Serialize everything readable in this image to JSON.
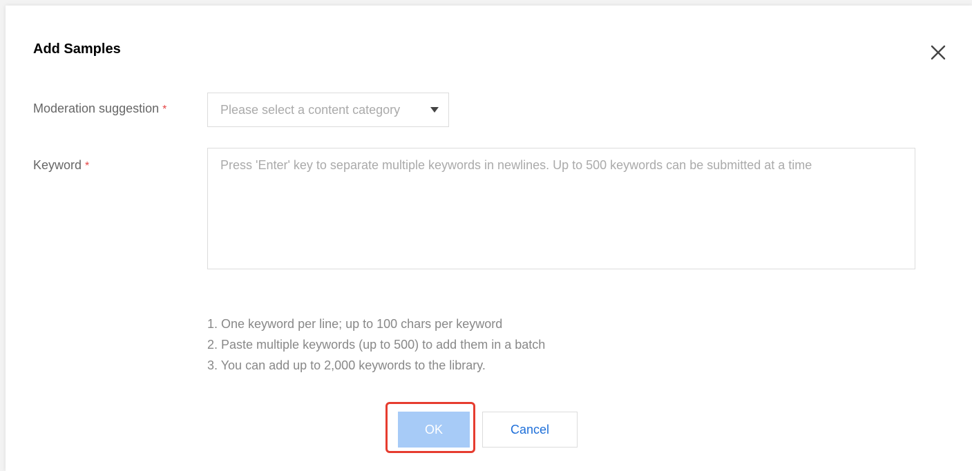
{
  "dialog": {
    "title": "Add Samples",
    "close_icon": "close-icon"
  },
  "form": {
    "moderation": {
      "label": "Moderation suggestion",
      "required_mark": "*",
      "placeholder": "Please select a content category"
    },
    "keyword": {
      "label": "Keyword",
      "required_mark": "*",
      "value": "",
      "placeholder": "Press 'Enter' key to separate multiple keywords in newlines. Up to 500 keywords can be submitted at a time"
    },
    "hints": [
      "1. One keyword per line; up to 100 chars per keyword",
      "2. Paste multiple keywords (up to 500) to add them in a batch",
      "3. You can add up to 2,000 keywords to the library."
    ]
  },
  "buttons": {
    "ok_label": "OK",
    "cancel_label": "Cancel"
  },
  "colors": {
    "ok_button_disabled": "#a7cbf7",
    "cancel_text": "#1e6fd9",
    "required_mark": "#e54545",
    "highlight_box": "#e63c2f"
  }
}
